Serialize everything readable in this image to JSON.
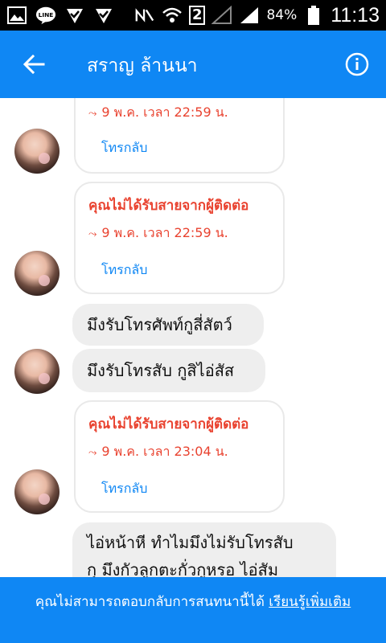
{
  "status_bar": {
    "sim_number": "2",
    "battery": "84%",
    "time": "11:13",
    "line_label": "LINE"
  },
  "header": {
    "title": "สราญ ล้านนา"
  },
  "messages": {
    "card1": {
      "time": "9 พ.ค. เวลา 22:59 น.",
      "callback": "โทรกลับ"
    },
    "card2": {
      "title": "คุณไม่ได้รับสายจากผู้ติดต่อ",
      "time": "9 พ.ค. เวลา 22:59 น.",
      "callback": "โทรกลับ"
    },
    "bubble1": "มึงรับโทรศัพท์กูสี่สัตว์",
    "bubble2": "มึงรับโทรสับ กูสิไอ่สัส",
    "card3": {
      "title": "คุณไม่ได้รับสายจากผู้ติดต่อ",
      "time": "9 พ.ค. เวลา 23:04 น.",
      "callback": "โทรกลับ"
    },
    "bubble3_line1": "ไอ่หน้าหี ทำไมมึงไม่รับโทรสับ",
    "bubble3_line2": "กุ  มึงกัวลูกตะกั่วกูหรอ ไอ่สัม"
  },
  "banner": {
    "text": "คุณไม่สามารถตอบกลับการสนทนานี้ได้ ",
    "link": "เรียนรู้เพิ่มเติม"
  },
  "icons": {
    "back": "arrow-left-icon",
    "info": "info-icon"
  },
  "colors": {
    "primary": "#0f87f4",
    "missed": "#e94330",
    "bubble": "#eeeeee"
  }
}
